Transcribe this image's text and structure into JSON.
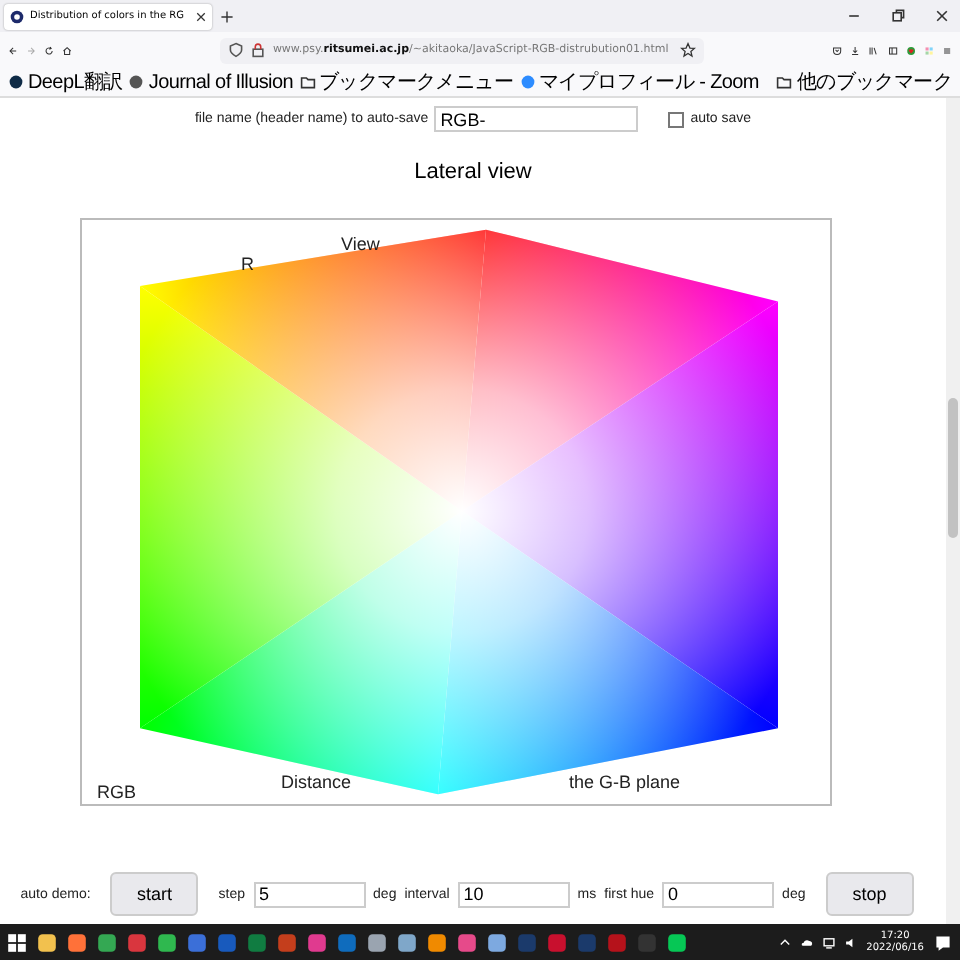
{
  "browser": {
    "tab": {
      "title": "Distribution of colors in the RG",
      "selected": true
    },
    "url": "www.psy.**ritsumei.ac.jp**/~akitaoka/JavaScript-RGB-distrubution01.html",
    "bookmarks": [
      {
        "label": "DeepL翻訳",
        "kind": "site"
      },
      {
        "label": "Journal of Illusion",
        "kind": "site"
      },
      {
        "label": "ブックマークメニュー",
        "kind": "folder"
      },
      {
        "label": "マイプロフィール - Zoom",
        "kind": "site"
      }
    ],
    "other_bookmarks": "他のブックマーク"
  },
  "page": {
    "autosave": {
      "label": "file name (header name) to auto-save",
      "value": "RGB-",
      "checkbox_label": "auto save",
      "checked": false
    },
    "heading": "Lateral view",
    "canvas": {
      "axis_label": "R",
      "top_caption": "View",
      "bottom_caption_left": "Distance",
      "bottom_caption_right": "the G-B plane",
      "corner_label": "RGB"
    },
    "controls": {
      "label": "auto demo:",
      "start": "start",
      "step_label": "step",
      "step": "5",
      "step_unit": "deg",
      "interval_label": "interval",
      "interval": "10",
      "interval_unit": "ms",
      "hue_label": "first hue",
      "hue": "0",
      "hue_unit": "deg",
      "stop": "stop"
    }
  },
  "taskbar": {
    "time": "17:20",
    "date": "2022/06/16"
  }
}
